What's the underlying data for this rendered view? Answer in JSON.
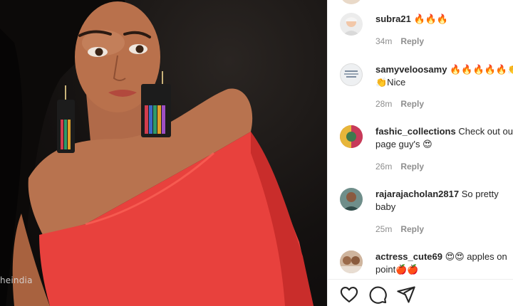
{
  "photo": {
    "watermark": "heindia"
  },
  "comments": [
    {
      "username": "subra21",
      "text": "🔥🔥🔥",
      "time": "34m",
      "reply": "Reply"
    },
    {
      "username": "samyveloosamy",
      "text": "🔥🔥🔥🔥🔥👏👏",
      "text2": "👏Nice",
      "time": "28m",
      "reply": "Reply"
    },
    {
      "username": "fashic_collections",
      "text": "Check out our",
      "text2": "page guy's 😍",
      "time": "26m",
      "reply": "Reply"
    },
    {
      "username": "rajarajacholan2817",
      "text": "So pretty",
      "text2": "baby",
      "time": "25m",
      "reply": "Reply"
    },
    {
      "username": "actress_cute69",
      "text": "😍😍 apples on",
      "text2": "point🍎🍎"
    }
  ],
  "actions": {
    "icons": [
      "heart-icon",
      "comment-icon",
      "share-icon"
    ]
  }
}
